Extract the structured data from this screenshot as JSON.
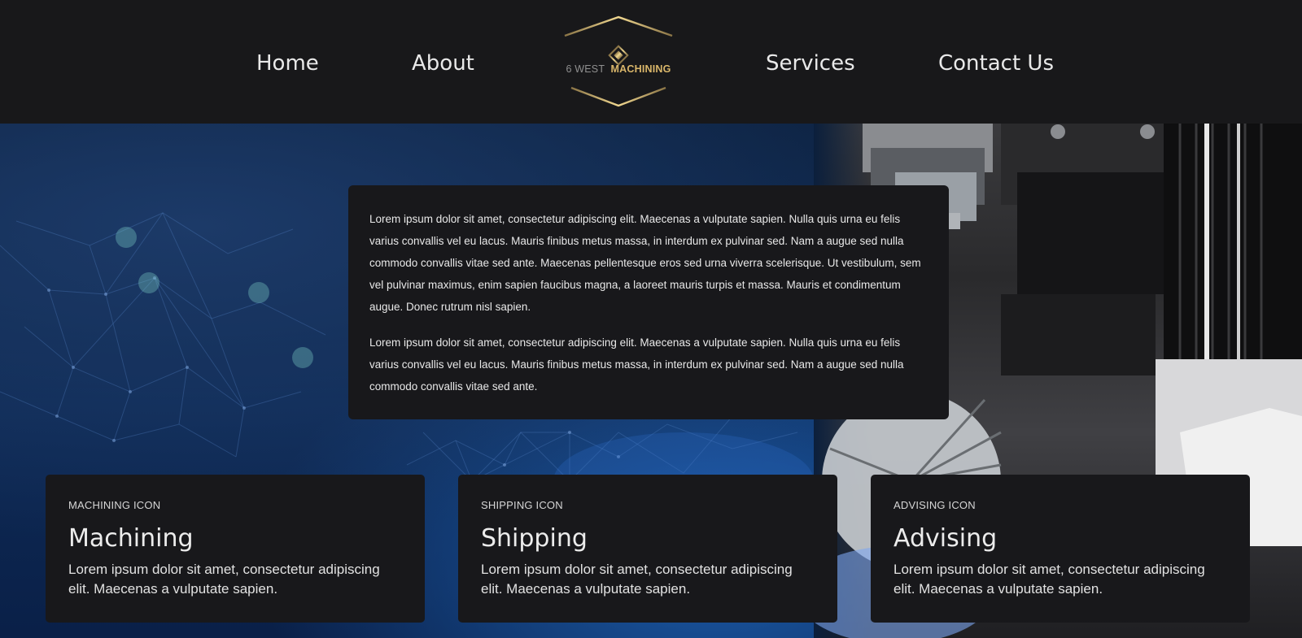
{
  "nav": {
    "left": [
      {
        "label": "Home"
      },
      {
        "label": "About"
      }
    ],
    "right": [
      {
        "label": "Services"
      },
      {
        "label": "Contact Us"
      }
    ]
  },
  "logo": {
    "word1": "6 WEST",
    "word2": "MACHINING",
    "gold": "#d9b66a"
  },
  "intro": {
    "paragraphs": [
      "Lorem ipsum dolor sit amet, consectetur adipiscing elit. Maecenas a vulputate sapien. Nulla quis urna eu felis varius convallis vel eu lacus. Mauris finibus metus massa, in interdum ex pulvinar sed. Nam a augue sed nulla commodo convallis vitae sed ante. Maecenas pellentesque eros sed urna viverra scelerisque. Ut vestibulum, sem vel pulvinar maximus, enim sapien faucibus magna, a laoreet mauris turpis et massa. Mauris et condimentum augue. Donec rutrum nisl sapien.",
      "Lorem ipsum dolor sit amet, consectetur adipiscing elit. Maecenas a vulputate sapien. Nulla quis urna eu felis varius convallis vel eu lacus. Mauris finibus metus massa, in interdum ex pulvinar sed. Nam a augue sed nulla commodo convallis vitae sed ante."
    ]
  },
  "cards": [
    {
      "icon_label": "MACHINING ICON",
      "title": "Machining",
      "text": "Lorem ipsum dolor sit amet, consectetur adipiscing elit. Maecenas a vulputate sapien."
    },
    {
      "icon_label": "SHIPPING ICON",
      "title": "Shipping",
      "text": "Lorem ipsum dolor sit amet, consectetur adipiscing elit. Maecenas a vulputate sapien."
    },
    {
      "icon_label": "ADVISING ICON",
      "title": "Advising",
      "text": "Lorem ipsum dolor sit amet, consectetur adipiscing elit. Maecenas a vulputate sapien."
    }
  ],
  "colors": {
    "background": "#18181b",
    "hero_blue": "#0e2a55",
    "text": "#e8e8e8"
  }
}
